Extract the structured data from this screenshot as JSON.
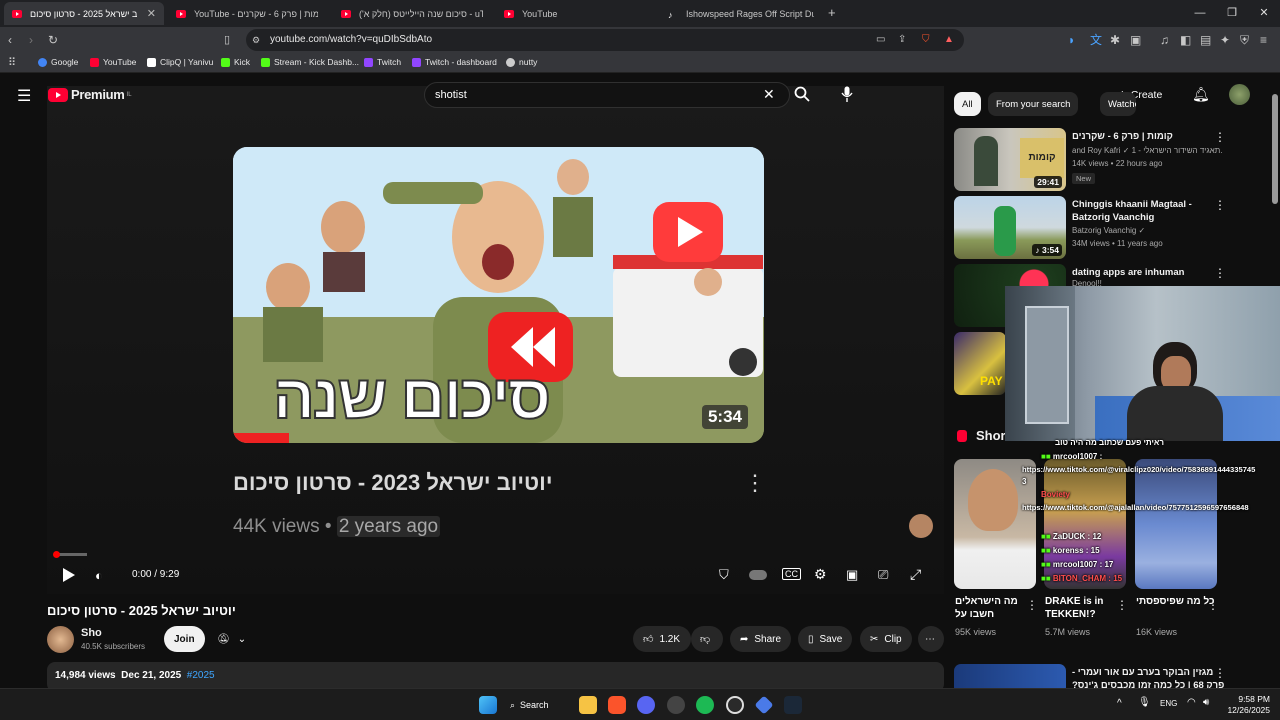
{
  "browser": {
    "tabs": [
      {
        "label": "יוטיוב ישראל 2025 - סרטון סיכום",
        "active": true
      },
      {
        "label": "YouTube - קומות | פרק 6 - שקרנים"
      },
      {
        "label": "סיכום שנה היילייטס (חלק א') - uTube"
      },
      {
        "label": "YouTube"
      },
      {
        "label": "Ishowspeed Rages Off Script During"
      }
    ],
    "new_tab": "+",
    "url": "youtube.com/watch?v=quDIbSdbAto",
    "bookmarks": [
      {
        "label": "Google",
        "color": "#4285f4"
      },
      {
        "label": "YouTube",
        "color": "#ff0033"
      },
      {
        "label": "ClipQ | Yanivu",
        "color": "#ffffff"
      },
      {
        "label": "Kick",
        "color": "#53fc18"
      },
      {
        "label": "Stream - Kick Dashb...",
        "color": "#53fc18"
      },
      {
        "label": "Twitch",
        "color": "#9146ff"
      },
      {
        "label": "Twitch - dashboard",
        "color": "#9146ff"
      },
      {
        "label": "nutty",
        "color": "#cccccc"
      }
    ]
  },
  "youtube": {
    "logo": "Premium",
    "logo_region": "IL",
    "search_query": "shotist",
    "create_label": "Create",
    "player": {
      "duration_badge": "5:34",
      "endcard_title": "יוטיוב ישראל 2023 - סרטון סיכום",
      "endcard_views": "44K views",
      "endcard_sep": "•",
      "endcard_age": "2 years ago",
      "time": "0:00 / 9:29",
      "progress": 0.0
    },
    "video": {
      "title": "יוטיוב ישראל 2025 - סרטון סיכום",
      "channel": "Sho",
      "subscribers": "40.5K subscribers",
      "join_label": "Join",
      "likes": "1.2K",
      "share_label": "Share",
      "save_label": "Save",
      "clip_label": "Clip",
      "views": "14,984 views",
      "date": "Dec 21, 2025",
      "hashtag": "#2025"
    },
    "chips": [
      "All",
      "From your search",
      "Watched"
    ],
    "recommendations": [
      {
        "title": "קומות | פרק 6 - שקרנים",
        "channel": "and Roy Kafri ✓ תאגיד השידור הישראלי - 1...",
        "meta": "14K views • 22 hours ago",
        "badge": "New",
        "duration": "29:41"
      },
      {
        "title": "Chinggis khaanii Magtaal - Batzorig Vaanchig",
        "channel": "Batzorig Vaanchig ✓",
        "meta": "34M views • 11 years ago",
        "duration": "3:54"
      },
      {
        "title": "dating apps are inhuman",
        "channel": "Denool!!",
        "meta": ""
      }
    ],
    "shorts_label": "Shorts",
    "shorts": [
      {
        "title": "מה הישראלים חשבו על",
        "views": "95K views"
      },
      {
        "title": "DRAKE is in TEKKEN!?",
        "views": "5.7M views"
      },
      {
        "title": "כל מה שפיספסתי",
        "views": "16K views"
      }
    ],
    "bottom_rec": {
      "title": "מגזין הבוקר בערב עם אור ועמרי - פרק 68 | כל כמה זמן מכבסים ג'ינס?"
    }
  },
  "chat": [
    {
      "text": "ראיתי פעם שכתוב מה היה טוב",
      "color": "#ffffff"
    },
    {
      "text": "mrcool1007 :",
      "color": "#ffffff"
    },
    {
      "text": "https://www.tiktok.com/@viralclipz020/video/75836891444335745",
      "color": "#ffffff"
    },
    {
      "text": "3",
      "color": "#ffffff"
    },
    {
      "text": "Boviety",
      "color": "#ff4d4d"
    },
    {
      "text": "https://www.tiktok.com/@ajalallan/video/7577512596597656848",
      "color": "#ffffff"
    },
    {
      "text": "ZaDUCK : 12",
      "color": "#ffffff"
    },
    {
      "text": "korenss : 15",
      "color": "#ffffff"
    },
    {
      "text": "mrcool1007 : 17",
      "color": "#ffffff"
    },
    {
      "text": "BITON_CHAM : 15",
      "color": "#ff4d4d"
    }
  ],
  "taskbar": {
    "search_label": "Search",
    "lang": "ENG",
    "time": "9:58 PM",
    "date": "12/26/2025"
  }
}
